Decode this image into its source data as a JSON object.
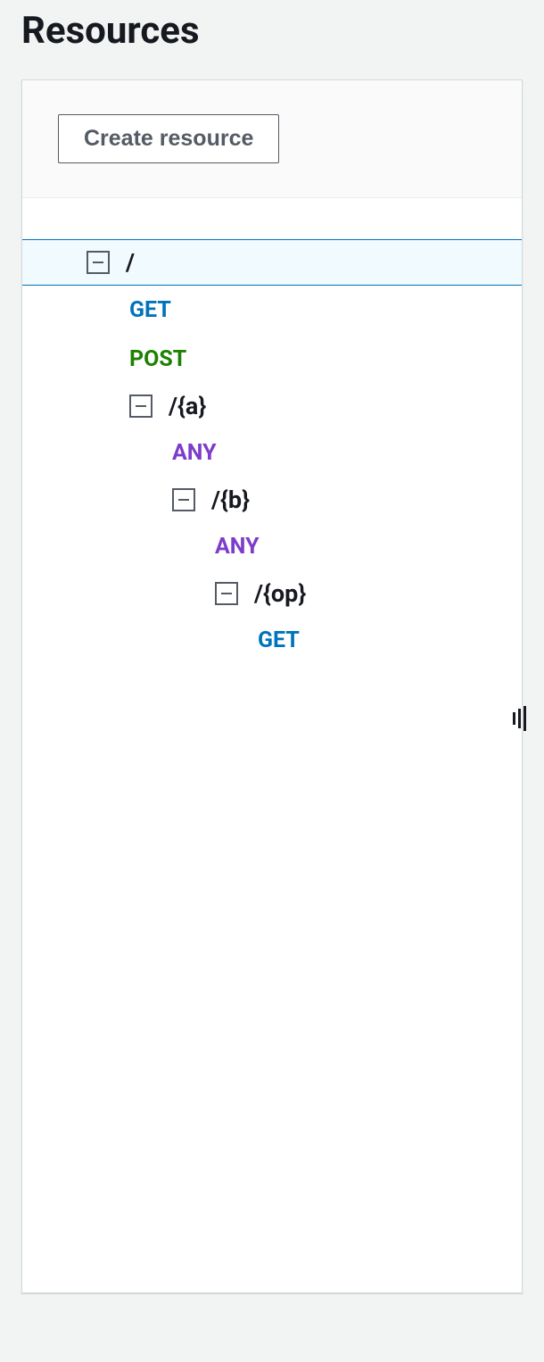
{
  "page": {
    "title": "Resources"
  },
  "toolbar": {
    "create_label": "Create resource"
  },
  "tree": {
    "root": {
      "label": "/",
      "methods": [
        "GET",
        "POST"
      ],
      "children": [
        {
          "label": "/{a}",
          "methods": [
            "ANY"
          ],
          "children": [
            {
              "label": "/{b}",
              "methods": [
                "ANY"
              ],
              "children": [
                {
                  "label": "/{op}",
                  "methods": [
                    "GET"
                  ],
                  "children": []
                }
              ]
            }
          ]
        }
      ]
    }
  },
  "method_colors": {
    "GET": "method-get",
    "POST": "method-post",
    "ANY": "method-any"
  }
}
